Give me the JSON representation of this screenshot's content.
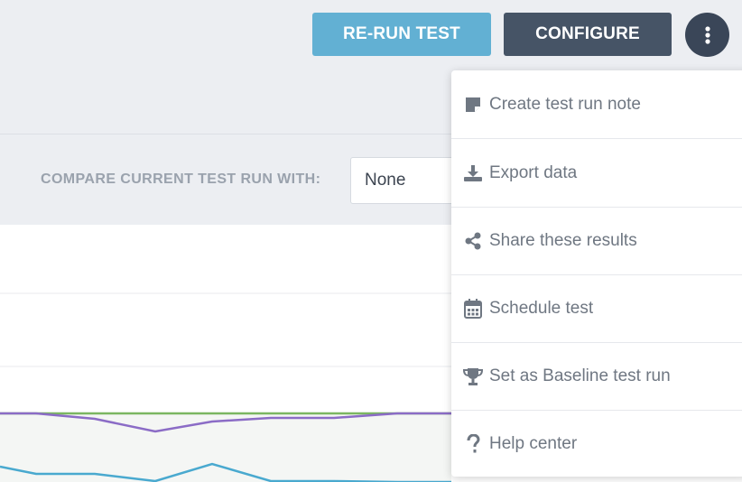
{
  "header": {
    "rerun_label": "RE-RUN TEST",
    "configure_label": "CONFIGURE",
    "more_icon": "vertical-ellipsis-icon"
  },
  "compare": {
    "label": "COMPARE CURRENT TEST RUN WITH:",
    "selected": "None"
  },
  "menu": {
    "items": [
      {
        "label": "Create test run note",
        "icon": "note-icon"
      },
      {
        "label": "Export data",
        "icon": "download-icon"
      },
      {
        "label": "Share these results",
        "icon": "share-icon"
      },
      {
        "label": "Schedule test",
        "icon": "calendar-icon"
      },
      {
        "label": "Set as Baseline test run",
        "icon": "trophy-icon"
      },
      {
        "label": "Help center",
        "icon": "question-icon"
      }
    ]
  },
  "colors": {
    "rerun": "#62b0d3",
    "configure": "#465466",
    "series_green": "#7bb661",
    "series_purple": "#8b6cc6",
    "series_blue": "#49a9cf"
  }
}
